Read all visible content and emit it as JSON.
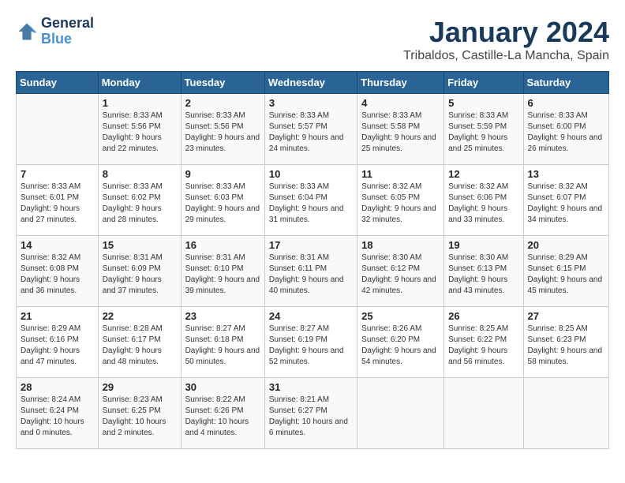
{
  "logo": {
    "text_general": "General",
    "text_blue": "Blue"
  },
  "title": "January 2024",
  "subtitle": "Tribaldos, Castille-La Mancha, Spain",
  "headers": [
    "Sunday",
    "Monday",
    "Tuesday",
    "Wednesday",
    "Thursday",
    "Friday",
    "Saturday"
  ],
  "weeks": [
    [
      {
        "day": "",
        "sunrise": "",
        "sunset": "",
        "daylight": ""
      },
      {
        "day": "1",
        "sunrise": "Sunrise: 8:33 AM",
        "sunset": "Sunset: 5:56 PM",
        "daylight": "Daylight: 9 hours and 22 minutes."
      },
      {
        "day": "2",
        "sunrise": "Sunrise: 8:33 AM",
        "sunset": "Sunset: 5:56 PM",
        "daylight": "Daylight: 9 hours and 23 minutes."
      },
      {
        "day": "3",
        "sunrise": "Sunrise: 8:33 AM",
        "sunset": "Sunset: 5:57 PM",
        "daylight": "Daylight: 9 hours and 24 minutes."
      },
      {
        "day": "4",
        "sunrise": "Sunrise: 8:33 AM",
        "sunset": "Sunset: 5:58 PM",
        "daylight": "Daylight: 9 hours and 25 minutes."
      },
      {
        "day": "5",
        "sunrise": "Sunrise: 8:33 AM",
        "sunset": "Sunset: 5:59 PM",
        "daylight": "Daylight: 9 hours and 25 minutes."
      },
      {
        "day": "6",
        "sunrise": "Sunrise: 8:33 AM",
        "sunset": "Sunset: 6:00 PM",
        "daylight": "Daylight: 9 hours and 26 minutes."
      }
    ],
    [
      {
        "day": "7",
        "sunrise": "Sunrise: 8:33 AM",
        "sunset": "Sunset: 6:01 PM",
        "daylight": "Daylight: 9 hours and 27 minutes."
      },
      {
        "day": "8",
        "sunrise": "Sunrise: 8:33 AM",
        "sunset": "Sunset: 6:02 PM",
        "daylight": "Daylight: 9 hours and 28 minutes."
      },
      {
        "day": "9",
        "sunrise": "Sunrise: 8:33 AM",
        "sunset": "Sunset: 6:03 PM",
        "daylight": "Daylight: 9 hours and 29 minutes."
      },
      {
        "day": "10",
        "sunrise": "Sunrise: 8:33 AM",
        "sunset": "Sunset: 6:04 PM",
        "daylight": "Daylight: 9 hours and 31 minutes."
      },
      {
        "day": "11",
        "sunrise": "Sunrise: 8:32 AM",
        "sunset": "Sunset: 6:05 PM",
        "daylight": "Daylight: 9 hours and 32 minutes."
      },
      {
        "day": "12",
        "sunrise": "Sunrise: 8:32 AM",
        "sunset": "Sunset: 6:06 PM",
        "daylight": "Daylight: 9 hours and 33 minutes."
      },
      {
        "day": "13",
        "sunrise": "Sunrise: 8:32 AM",
        "sunset": "Sunset: 6:07 PM",
        "daylight": "Daylight: 9 hours and 34 minutes."
      }
    ],
    [
      {
        "day": "14",
        "sunrise": "Sunrise: 8:32 AM",
        "sunset": "Sunset: 6:08 PM",
        "daylight": "Daylight: 9 hours and 36 minutes."
      },
      {
        "day": "15",
        "sunrise": "Sunrise: 8:31 AM",
        "sunset": "Sunset: 6:09 PM",
        "daylight": "Daylight: 9 hours and 37 minutes."
      },
      {
        "day": "16",
        "sunrise": "Sunrise: 8:31 AM",
        "sunset": "Sunset: 6:10 PM",
        "daylight": "Daylight: 9 hours and 39 minutes."
      },
      {
        "day": "17",
        "sunrise": "Sunrise: 8:31 AM",
        "sunset": "Sunset: 6:11 PM",
        "daylight": "Daylight: 9 hours and 40 minutes."
      },
      {
        "day": "18",
        "sunrise": "Sunrise: 8:30 AM",
        "sunset": "Sunset: 6:12 PM",
        "daylight": "Daylight: 9 hours and 42 minutes."
      },
      {
        "day": "19",
        "sunrise": "Sunrise: 8:30 AM",
        "sunset": "Sunset: 6:13 PM",
        "daylight": "Daylight: 9 hours and 43 minutes."
      },
      {
        "day": "20",
        "sunrise": "Sunrise: 8:29 AM",
        "sunset": "Sunset: 6:15 PM",
        "daylight": "Daylight: 9 hours and 45 minutes."
      }
    ],
    [
      {
        "day": "21",
        "sunrise": "Sunrise: 8:29 AM",
        "sunset": "Sunset: 6:16 PM",
        "daylight": "Daylight: 9 hours and 47 minutes."
      },
      {
        "day": "22",
        "sunrise": "Sunrise: 8:28 AM",
        "sunset": "Sunset: 6:17 PM",
        "daylight": "Daylight: 9 hours and 48 minutes."
      },
      {
        "day": "23",
        "sunrise": "Sunrise: 8:27 AM",
        "sunset": "Sunset: 6:18 PM",
        "daylight": "Daylight: 9 hours and 50 minutes."
      },
      {
        "day": "24",
        "sunrise": "Sunrise: 8:27 AM",
        "sunset": "Sunset: 6:19 PM",
        "daylight": "Daylight: 9 hours and 52 minutes."
      },
      {
        "day": "25",
        "sunrise": "Sunrise: 8:26 AM",
        "sunset": "Sunset: 6:20 PM",
        "daylight": "Daylight: 9 hours and 54 minutes."
      },
      {
        "day": "26",
        "sunrise": "Sunrise: 8:25 AM",
        "sunset": "Sunset: 6:22 PM",
        "daylight": "Daylight: 9 hours and 56 minutes."
      },
      {
        "day": "27",
        "sunrise": "Sunrise: 8:25 AM",
        "sunset": "Sunset: 6:23 PM",
        "daylight": "Daylight: 9 hours and 58 minutes."
      }
    ],
    [
      {
        "day": "28",
        "sunrise": "Sunrise: 8:24 AM",
        "sunset": "Sunset: 6:24 PM",
        "daylight": "Daylight: 10 hours and 0 minutes."
      },
      {
        "day": "29",
        "sunrise": "Sunrise: 8:23 AM",
        "sunset": "Sunset: 6:25 PM",
        "daylight": "Daylight: 10 hours and 2 minutes."
      },
      {
        "day": "30",
        "sunrise": "Sunrise: 8:22 AM",
        "sunset": "Sunset: 6:26 PM",
        "daylight": "Daylight: 10 hours and 4 minutes."
      },
      {
        "day": "31",
        "sunrise": "Sunrise: 8:21 AM",
        "sunset": "Sunset: 6:27 PM",
        "daylight": "Daylight: 10 hours and 6 minutes."
      },
      {
        "day": "",
        "sunrise": "",
        "sunset": "",
        "daylight": ""
      },
      {
        "day": "",
        "sunrise": "",
        "sunset": "",
        "daylight": ""
      },
      {
        "day": "",
        "sunrise": "",
        "sunset": "",
        "daylight": ""
      }
    ]
  ]
}
